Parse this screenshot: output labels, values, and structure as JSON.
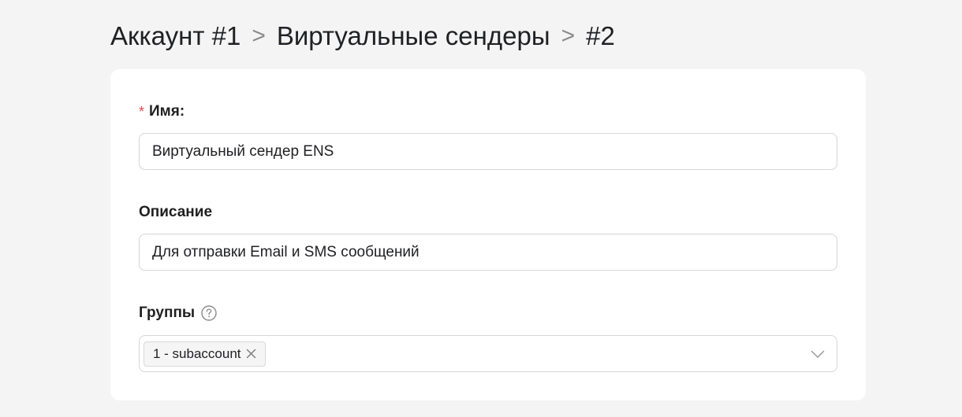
{
  "breadcrumb": {
    "items": [
      "Аккаунт #1",
      "Виртуальные сендеры",
      "#2"
    ],
    "separator": ">"
  },
  "form": {
    "name": {
      "required_mark": "*",
      "label": "Имя:",
      "value": "Виртуальный сендер ENS"
    },
    "description": {
      "label": "Описание",
      "value": "Для отправки Email и SMS сообщений"
    },
    "groups": {
      "label": "Группы",
      "help_icon": "question-circle-icon",
      "selected": [
        "1 - subaccount"
      ],
      "dropdown_icon": "chevron-down-icon"
    }
  },
  "colors": {
    "background": "#f4f4f4",
    "card": "#ffffff",
    "required": "#e5484d",
    "border": "#d6d6d6"
  }
}
